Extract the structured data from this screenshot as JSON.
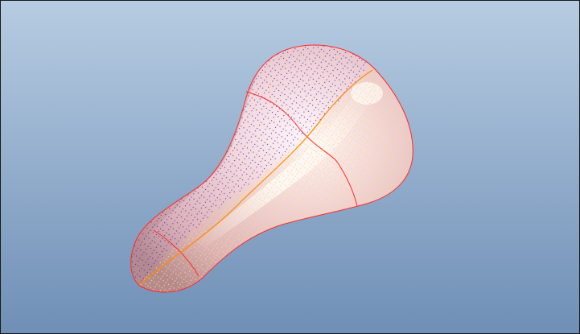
{
  "viewport": {
    "background_top": "#b7cce2",
    "background_bottom": "#6f8fb6"
  },
  "model": {
    "name": "saddle-surface",
    "surface_fill": "#e9c4c8",
    "surface_highlight": "#fff4f6",
    "edge_color": "#ff2a2a",
    "centerline_color": "#ff8a00",
    "mesh_left_color": "#3a20c8",
    "mesh_right_color": "#ffe04a"
  }
}
